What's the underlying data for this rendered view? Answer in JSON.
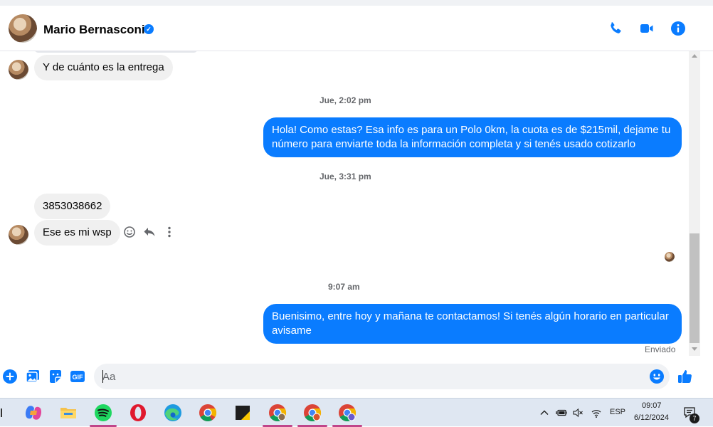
{
  "header": {
    "contact_name": "Mario Bernasconi",
    "verified_icon": "verified-badge-icon",
    "actions": [
      "phone-icon",
      "video-camera-icon",
      "info-icon"
    ]
  },
  "messages": {
    "m1": "Y de cuánto es la entrega",
    "ts1": "Jue, 2:02 pm",
    "m2": "Hola! Como estas? Esa info es para un Polo 0km, la cuota es de $215mil, dejame tu número para enviarte toda la información completa y si tenés usado cotizarlo",
    "ts2": "Jue, 3:31 pm",
    "m3": "3853038662",
    "m4": "Ese es mi wsp",
    "ts3": "9:07 am",
    "m5": "Buenisimo, entre hoy y mañana te contactamos! Si tenés algún horario en particular avisame",
    "status": "Enviado"
  },
  "composer": {
    "placeholder": "Aa",
    "icons": [
      "plus-icon",
      "image-icon",
      "sticker-icon",
      "gif-icon",
      "emoji-icon",
      "like-icon"
    ]
  },
  "taskbar": {
    "language": "ESP",
    "time": "09:07",
    "date": "6/12/2024",
    "notification_count": "7"
  },
  "colors": {
    "accent": "#0a7cff",
    "incoming_bubble": "#f0f0f0",
    "taskbar": "#dfe7f2"
  }
}
